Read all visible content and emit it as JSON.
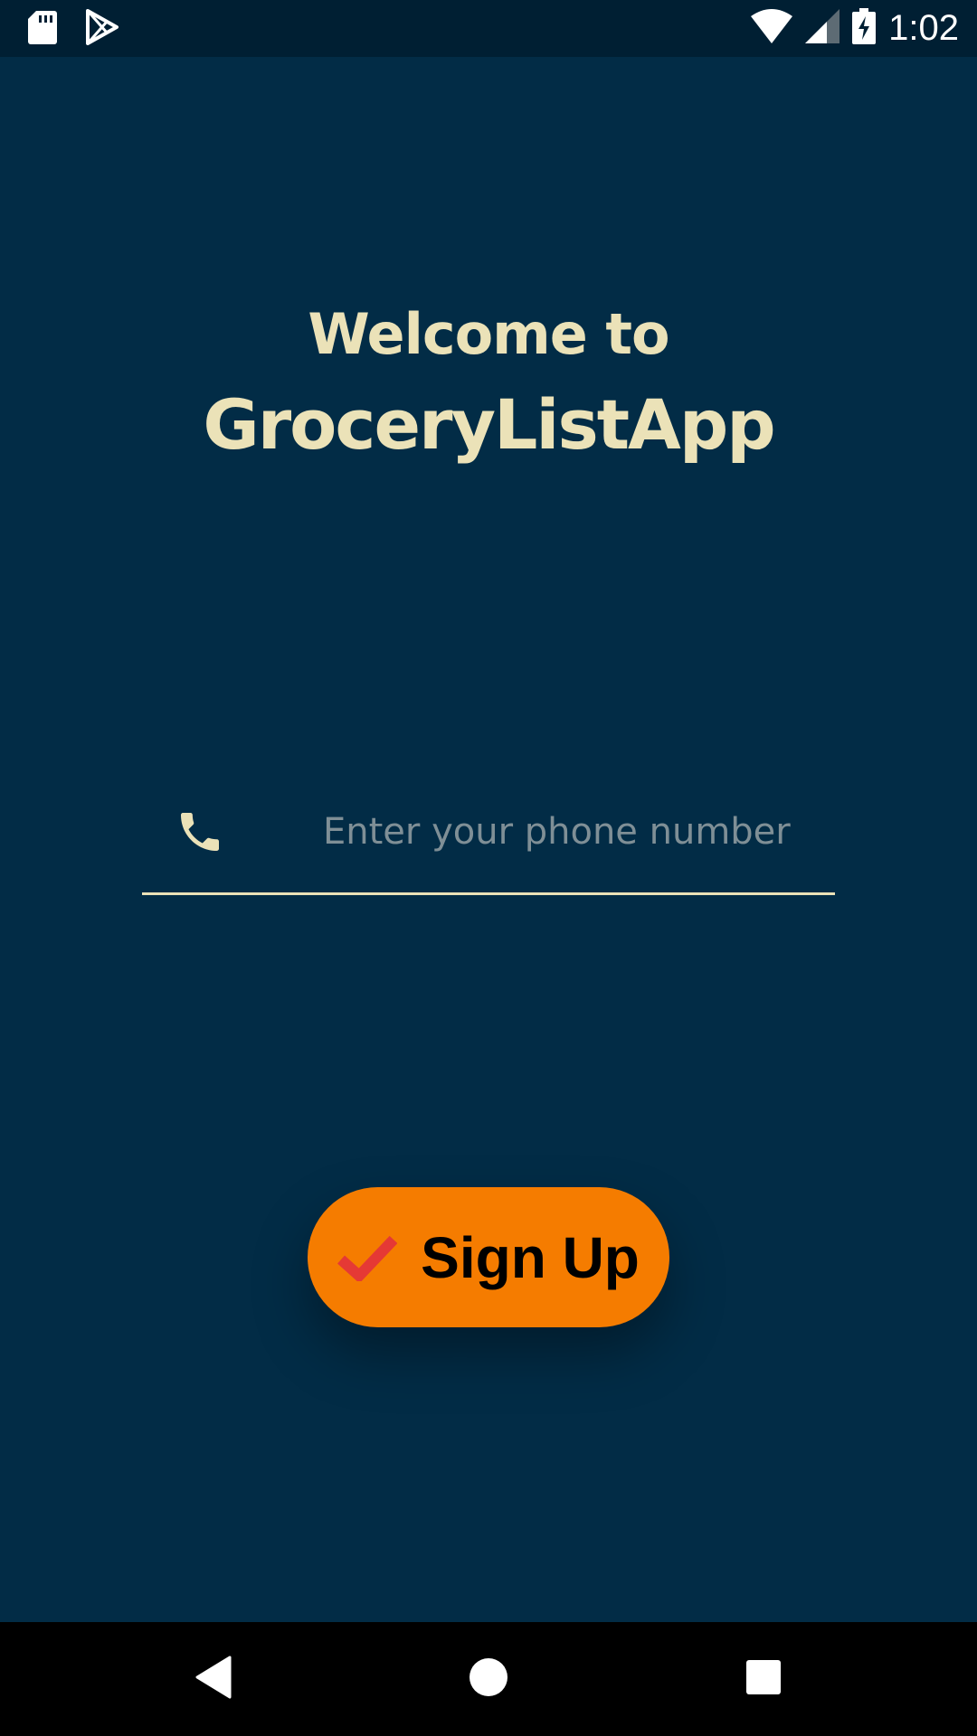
{
  "status_bar": {
    "time": "1:02",
    "left_icons": [
      "sd-card-icon",
      "play-store-icon"
    ],
    "right_icons": [
      "wifi-icon",
      "signal-icon",
      "battery-charging-icon"
    ]
  },
  "welcome": {
    "line1": "Welcome to",
    "app_name": "GroceryListApp"
  },
  "phone_field": {
    "icon": "phone-icon",
    "placeholder": "Enter your phone number",
    "value": ""
  },
  "signup_button": {
    "icon": "check-icon",
    "label": "Sign Up"
  },
  "nav_bar": {
    "items": [
      "back-icon",
      "home-icon",
      "recents-icon"
    ]
  },
  "colors": {
    "background": "#022c46",
    "status_bar": "#001f33",
    "accent_text": "#ebe2b8",
    "button": "#f57c00",
    "check": "#e53935",
    "placeholder": "#7f8f96"
  }
}
